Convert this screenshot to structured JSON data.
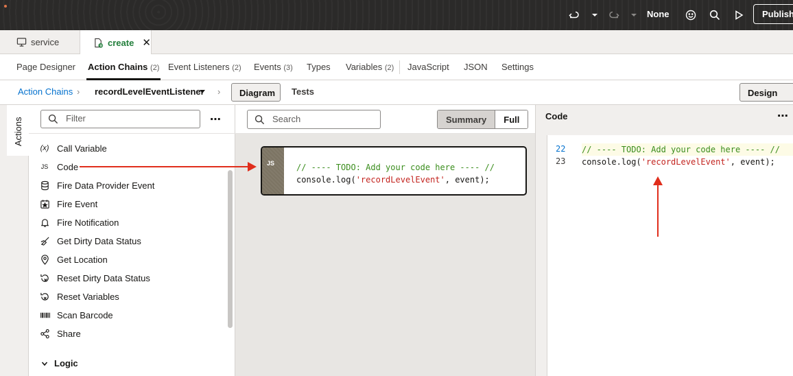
{
  "header": {
    "mode_label": "None",
    "publish_label": "Publish"
  },
  "file_tabs": [
    {
      "label": "service"
    },
    {
      "label": "create"
    }
  ],
  "nav_tabs": [
    {
      "label": "Page Designer",
      "count": ""
    },
    {
      "label": "Action Chains",
      "count": "(2)"
    },
    {
      "label": "Event Listeners",
      "count": "(2)"
    },
    {
      "label": "Events",
      "count": "(3)"
    },
    {
      "label": "Types",
      "count": ""
    },
    {
      "label": "Variables",
      "count": "(2)"
    },
    {
      "label": "JavaScript",
      "count": ""
    },
    {
      "label": "JSON",
      "count": ""
    },
    {
      "label": "Settings",
      "count": ""
    }
  ],
  "breadcrumb": {
    "root": "Action Chains",
    "current": "recordLevelEventListener",
    "diagram": "Diagram",
    "tests": "Tests",
    "design": "Design"
  },
  "sidebar": {
    "tab": "Actions",
    "filter_placeholder": "Filter",
    "items": [
      {
        "label": "Call Variable",
        "icon": "variable-icon"
      },
      {
        "label": "Code",
        "icon": "js-icon"
      },
      {
        "label": "Fire Data Provider Event",
        "icon": "database-icon"
      },
      {
        "label": "Fire Event",
        "icon": "event-icon"
      },
      {
        "label": "Fire Notification",
        "icon": "bell-icon"
      },
      {
        "label": "Get Dirty Data Status",
        "icon": "broom-icon"
      },
      {
        "label": "Get Location",
        "icon": "location-pin-icon"
      },
      {
        "label": "Reset Dirty Data Status",
        "icon": "reset-icon"
      },
      {
        "label": "Reset Variables",
        "icon": "reset-variables-icon"
      },
      {
        "label": "Scan Barcode",
        "icon": "barcode-icon"
      },
      {
        "label": "Share",
        "icon": "share-icon"
      }
    ],
    "section": "Logic"
  },
  "canvas": {
    "search_placeholder": "Search",
    "summary_label": "Summary",
    "full_label": "Full",
    "node": {
      "badge": "JS",
      "line1": "// ---- TODO: Add your code here ---- //",
      "line2_prefix": "console.log(",
      "line2_string": "'recordLevelEvent'",
      "line2_suffix": ", event);"
    }
  },
  "code_panel": {
    "title": "Code",
    "lines": [
      {
        "number": "22",
        "text": "// ---- TODO: Add your code here ---- //"
      },
      {
        "number": "23",
        "prefix": "console.log(",
        "string": "'recordLevelEvent'",
        "suffix": ", event);"
      }
    ]
  },
  "colors": {
    "accent_link": "#0572ce",
    "comment": "#3a8d1c",
    "string": "#c3241f",
    "annotation_arrow": "#e02d1b",
    "active_file_tab": "#227e3b"
  }
}
